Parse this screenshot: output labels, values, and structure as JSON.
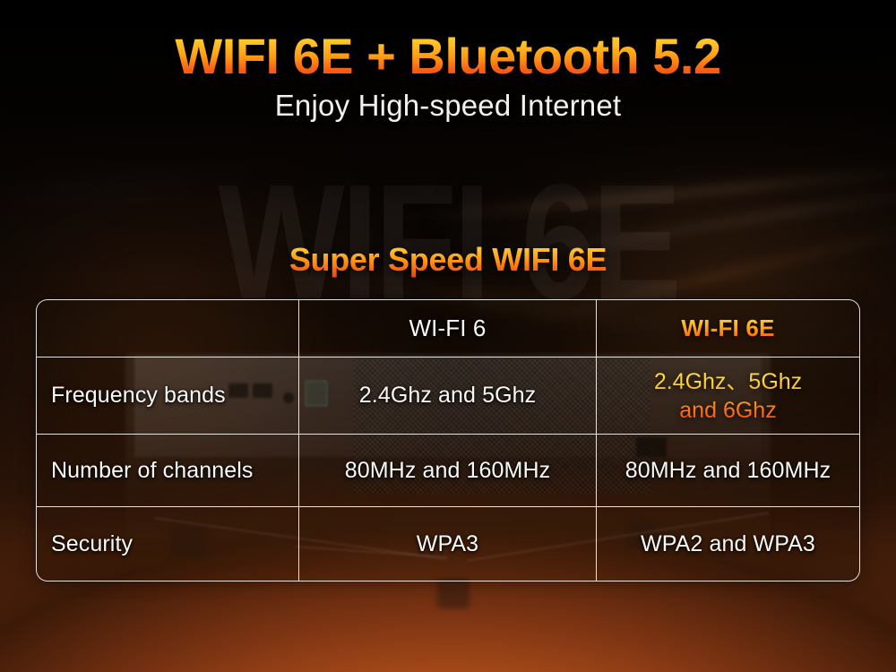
{
  "hero": {
    "title": "WIFI 6E + Bluetooth 5.2",
    "subtitle": "Enjoy High-speed Internet"
  },
  "section": {
    "title": "Super Speed WIFI 6E"
  },
  "background": {
    "watermark_text": "WIFI 6E"
  },
  "colors": {
    "accent_gold": "#ffd23c",
    "accent_orange": "#ff9a14",
    "accent_red": "#f23f12",
    "text_white": "#fbfaf9",
    "border": "#faf8f6",
    "bg_bottom_glow": "#b4501a"
  },
  "table": {
    "columns": [
      {
        "key": "label",
        "header": ""
      },
      {
        "key": "wifi6",
        "header": "WI-FI 6"
      },
      {
        "key": "wifi6e",
        "header": "WI-FI 6E"
      }
    ],
    "rows": [
      {
        "label": "Frequency bands",
        "wifi6": "2.4Ghz and 5Ghz",
        "wifi6e_line1": "2.4Ghz、5Ghz",
        "wifi6e_line2": "and 6Ghz"
      },
      {
        "label": "Number of channels",
        "wifi6": "80MHz and 160MHz",
        "wifi6e": "80MHz and 160MHz"
      },
      {
        "label": "Security",
        "wifi6": "WPA3",
        "wifi6e": "WPA2 and WPA3"
      }
    ]
  }
}
